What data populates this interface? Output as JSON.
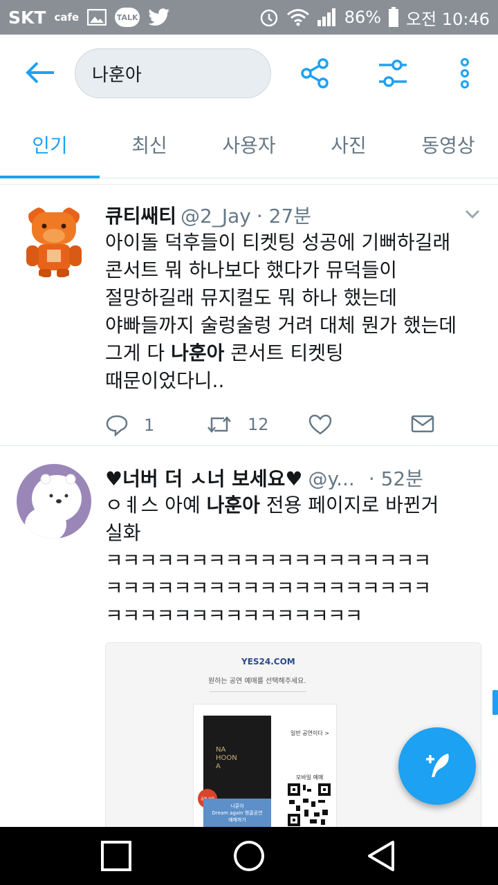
{
  "status_bar": {
    "carrier": "SKT",
    "cafe": "cafe",
    "talk": "TALK",
    "battery": "86%",
    "time": "오전 10:46"
  },
  "search": {
    "query": "나훈아"
  },
  "tabs": [
    {
      "label": "인기",
      "active": true
    },
    {
      "label": "최신",
      "active": false
    },
    {
      "label": "사용자",
      "active": false
    },
    {
      "label": "사진",
      "active": false
    },
    {
      "label": "동영상",
      "active": false
    }
  ],
  "tweets": [
    {
      "name": "큐티쌔티",
      "handle": "@2_Jay",
      "time": "· 27분",
      "lines": [
        "아이돌 덕후들이 티켓팅 성공에 기뻐하길래",
        "콘서트 뭐 하나보다 했다가 뮤덕들이",
        "절망하길래 뮤지컬도 뭐 하나 했는데",
        "야빠들까지 술렁술렁 거려 대체 뭔가 했는데"
      ],
      "line5_pre": "그게 다 ",
      "line5_bold": "나훈아",
      "line5_post": " 콘서트 티켓팅",
      "line6": "때문이었다니..",
      "replies": "1",
      "retweets": "12"
    },
    {
      "name": "♥너버 더 ㅅ너 보세요♥",
      "handle": "@y...",
      "time": "· 52분",
      "line1_pre": "ㅇㅖ스 아예 ",
      "line1_bold": "나훈아",
      "line1_post": " 전용 페이지로 바뀐거",
      "line2": "실화",
      "lines_k": [
        "ㅋㅋㅋㅋㅋㅋㅋㅋㅋㅋㅋㅋㅋㅋㅋㅋㅋㅋㅋ",
        "ㅋㅋㅋㅋㅋㅋㅋㅋㅋㅋㅋㅋㅋㅋㅋㅋㅋㅋㅋ",
        "ㅋㅋㅋㅋㅋㅋㅋㅋㅋㅋㅋㅋㅋㅋㅋ"
      ],
      "media": {
        "logo": "YES24.COM",
        "prompt": "원하는 공연 예매를 선택해주세요.",
        "poster_title": "NA HOON A",
        "badge": "공연 관람",
        "caption1": "나훈아",
        "caption2": "Dream again 앵콜공연",
        "caption3": "예매하기",
        "general": "일반 공연이다 >",
        "mobile": "모바일 예매"
      }
    }
  ],
  "icons": [
    "back-arrow-icon",
    "share-icon",
    "filter-icon",
    "more-icon",
    "reply-icon",
    "retweet-icon",
    "like-icon",
    "message-icon",
    "compose-icon"
  ],
  "colors": {
    "accent": "#1da1f2",
    "text": "#14171a",
    "muted": "#657786",
    "statusbar": "#8a8f96"
  }
}
